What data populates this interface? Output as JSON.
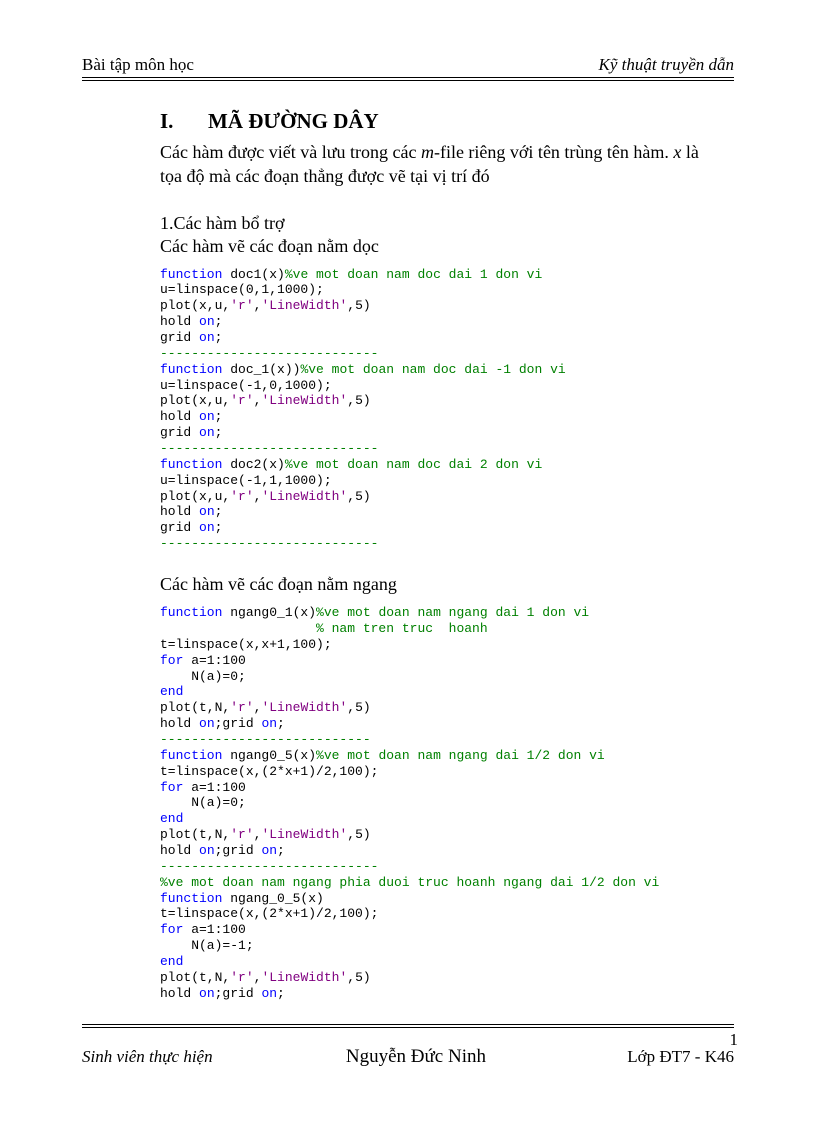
{
  "header": {
    "left": "Bài tập môn học",
    "right": "Kỹ thuật truyền dẫn"
  },
  "section": {
    "num": "I.",
    "title": "MÃ ĐƯỜNG DÂY",
    "intro_a": "Các hàm được viết và lưu trong các ",
    "mfile": "m",
    "intro_b": "-file riêng với tên trùng tên hàm. ",
    "xvar": "x",
    "intro_c": " là tọa độ mà các đoạn thẳng được vẽ tại vị trí đó"
  },
  "sub1": "1.Các hàm bổ trợ",
  "sub_doc": "Các hàm vẽ các đoạn nằm dọc",
  "sub_ngang": "Các hàm vẽ các đoạn nằm ngang",
  "code1": {
    "l1a": "function",
    "l1b": " doc1(x)",
    "l1c": "%ve mot doan nam doc dai 1 don vi",
    "l2": "u=linspace(0,1,1000);",
    "l3a": "plot(x,u,",
    "l3b": "'r'",
    "l3c": ",",
    "l3d": "'LineWidth'",
    "l3e": ",5)",
    "l4a": "hold ",
    "l4b": "on",
    "l4c": ";",
    "l5a": "grid ",
    "l5b": "on",
    "l5c": ";",
    "dash": "----------------------------",
    "l6a": "function",
    "l6b": " doc_1(x))",
    "l6c": "%ve mot doan nam doc dai -1 don vi",
    "l7": "u=linspace(-1,0,1000);",
    "l8a": "function",
    "l8b": " doc2(x)",
    "l8c": "%ve mot doan nam doc dai 2 don vi",
    "l9": "u=linspace(-1,1,1000);"
  },
  "code2": {
    "l1a": "function",
    "l1b": " ngang0_1(x)",
    "l1c": "%ve mot doan nam ngang dai 1 don vi",
    "l1d": "                    % nam tren truc  hoanh",
    "l2": "t=linspace(x,x+1,100);",
    "l3a": "for",
    "l3b": " a=1:100",
    "l4": "    N(a)=0;",
    "l5": "end",
    "l6a": "plot(t,N,",
    "l6b": "'r'",
    "l6c": ",",
    "l6d": "'LineWidth'",
    "l6e": ",5)",
    "l7a": "hold ",
    "l7b": "on",
    "l7c": ";grid ",
    "l7d": "on",
    "l7e": ";",
    "dash": "---------------------------",
    "l8a": "function",
    "l8b": " ngang0_5(x)",
    "l8c": "%ve mot doan nam ngang dai 1/2 don vi",
    "l9": "t=linspace(x,(2*x+1)/2,100);",
    "dash2": "----------------------------",
    "l10": "%ve mot doan nam ngang phia duoi truc hoanh ngang dai 1/2 don vi",
    "l11a": "function",
    "l11b": " ngang_0_5(x)",
    "l12": "t=linspace(x,(2*x+1)/2,100);",
    "l13": "    N(a)=-1;"
  },
  "footer": {
    "left": "Sinh viên thực hiện",
    "name": "Nguyễn Đức Ninh",
    "class": "Lớp ĐT7 - K46",
    "page": "1"
  }
}
